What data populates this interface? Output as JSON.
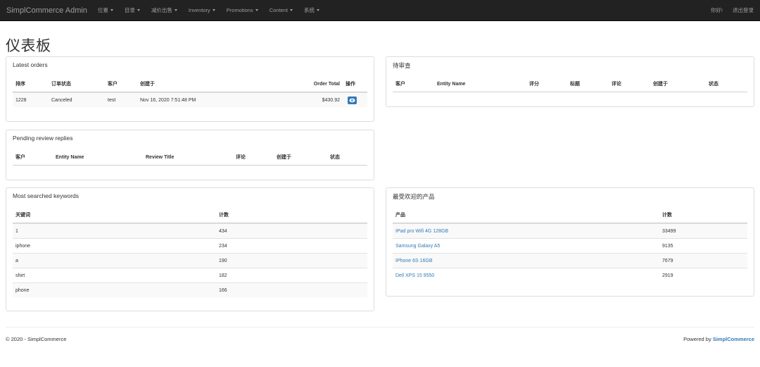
{
  "navbar": {
    "brand": "SimplCommerce Admin",
    "menu": [
      "位置",
      "目录",
      "减价出售",
      "Inventory",
      "Promotions",
      "Content",
      "系统"
    ],
    "greeting": "你好!",
    "logout": "退出登录"
  },
  "page": {
    "title": "仪表板"
  },
  "latest_orders": {
    "title": "Latest orders",
    "headers": [
      "排序",
      "订单状态",
      "客户",
      "创建于",
      "Order Total",
      "操作"
    ],
    "rows": [
      {
        "id": "1228",
        "status": "Canceled",
        "customer": "test",
        "created": "Nov 16, 2020 7:51:48 PM",
        "total": "$430.92"
      }
    ]
  },
  "pending_review": {
    "title": "待审查",
    "headers": [
      "客户",
      "Entity Name",
      "评分",
      "标题",
      "评论",
      "创建于",
      "状态"
    ]
  },
  "pending_replies": {
    "title": "Pending review replies",
    "headers": [
      "客户",
      "Entity Name",
      "Review Title",
      "评论",
      "创建于",
      "状态"
    ]
  },
  "keywords": {
    "title": "Most searched keywords",
    "headers": [
      "关键词",
      "计数"
    ],
    "rows": [
      {
        "keyword": "1",
        "count": "434"
      },
      {
        "keyword": "iphone",
        "count": "234"
      },
      {
        "keyword": "a",
        "count": "190"
      },
      {
        "keyword": "shirt",
        "count": "182"
      },
      {
        "keyword": "phone",
        "count": "166"
      }
    ]
  },
  "popular_products": {
    "title": "最受欢迎的产品",
    "headers": [
      "产品",
      "计数"
    ],
    "rows": [
      {
        "product": "IPad pro Wifi 4G 128GB",
        "count": "33499"
      },
      {
        "product": "Samsung Galaxy A5",
        "count": "9135"
      },
      {
        "product": "IPhone 6S 16GB",
        "count": "7679"
      },
      {
        "product": "Dell XPS 15 9550",
        "count": "2919"
      }
    ]
  },
  "footer": {
    "copyright": "© 2020 - SimplCommerce",
    "powered_by": "Powered by",
    "powered_brand": "SimplCommerce"
  },
  "colors": {
    "navbar_bg": "#222222",
    "link": "#337ab7",
    "border": "#dddddd"
  },
  "icons": {
    "view_order": "eye-icon",
    "menu_dropdown": "caret-down-icon"
  }
}
